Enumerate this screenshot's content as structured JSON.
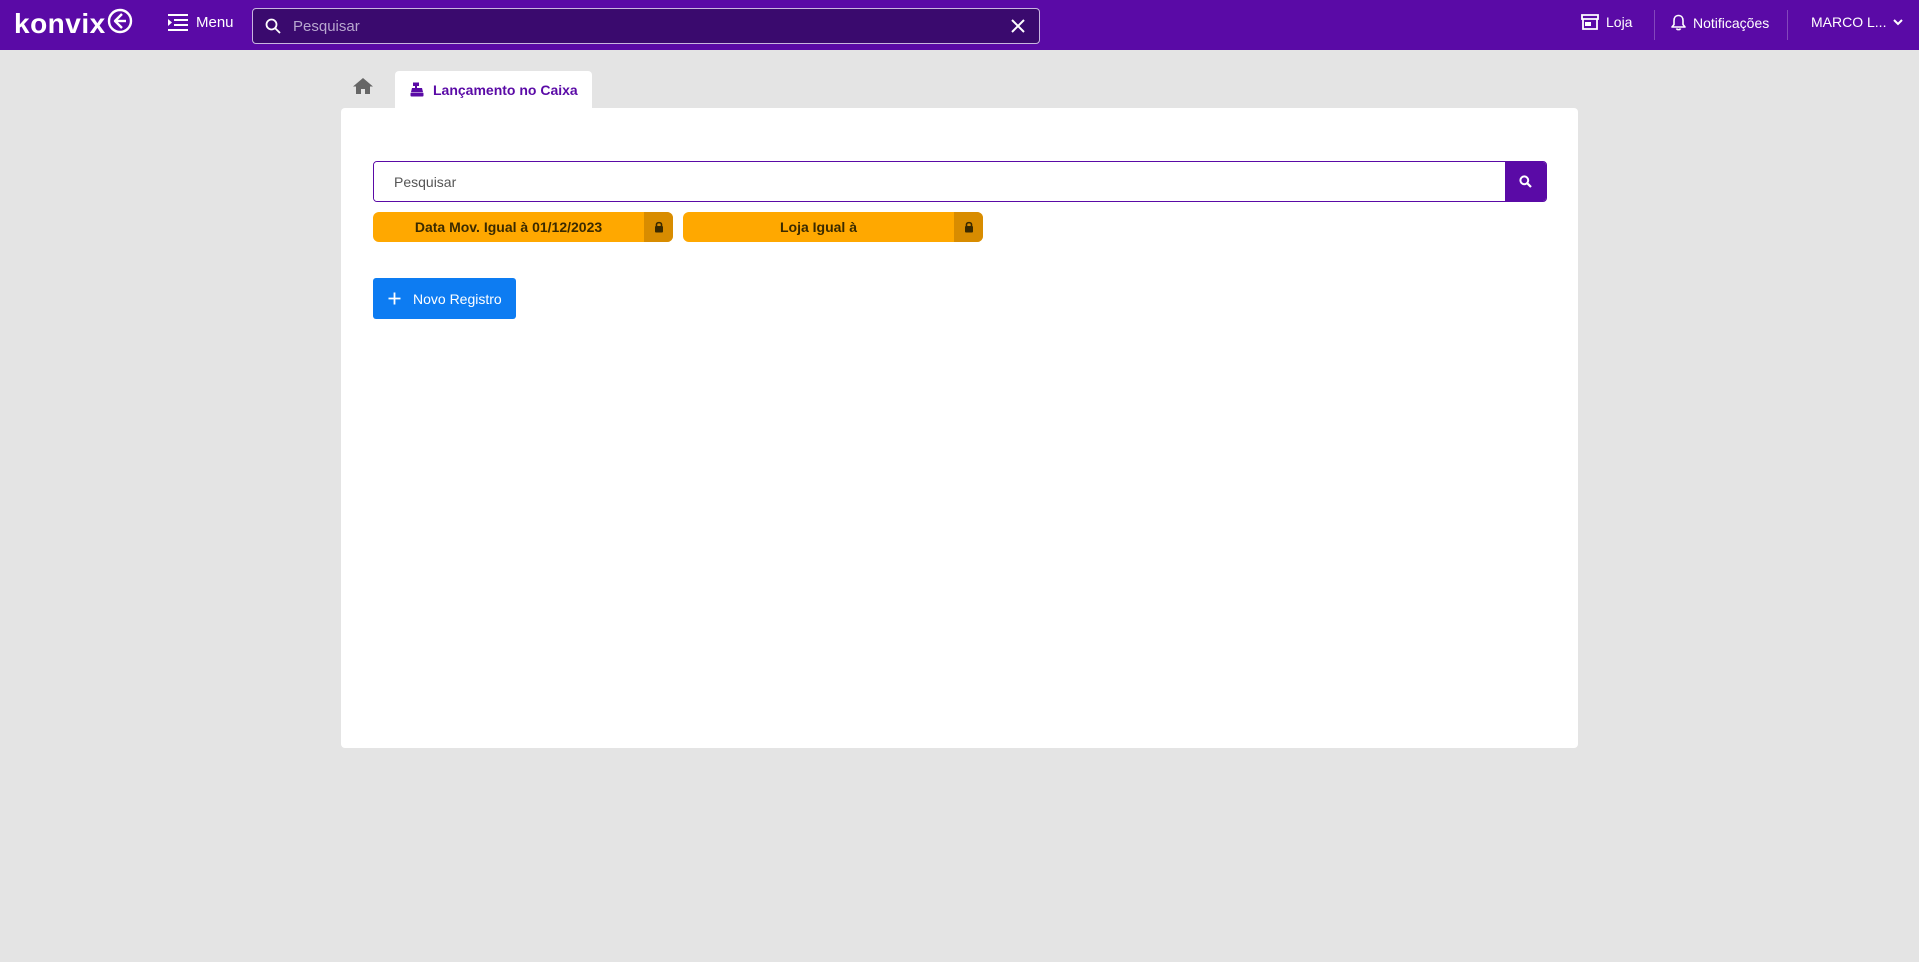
{
  "brand": {
    "logo_text": "Konvix",
    "primary_color": "#5a0aa6",
    "accent_orange": "#ffa800",
    "accent_blue": "#0d7cf2"
  },
  "topbar": {
    "menu_label": "Menu",
    "search_placeholder": "Pesquisar",
    "store_label": "Loja",
    "notifications_label": "Notificações",
    "user_label": "MARCO L..."
  },
  "tabs": {
    "home_icon": "home-icon",
    "active_label": "Lançamento no Caixa",
    "active_icon": "cash-register-icon"
  },
  "main": {
    "search_placeholder": "Pesquisar",
    "filters": [
      {
        "label": "Data Mov. Igual à 01/12/2023",
        "locked": true
      },
      {
        "label": "Loja Igual à",
        "locked": true
      }
    ],
    "new_button_label": "Novo Registro"
  }
}
